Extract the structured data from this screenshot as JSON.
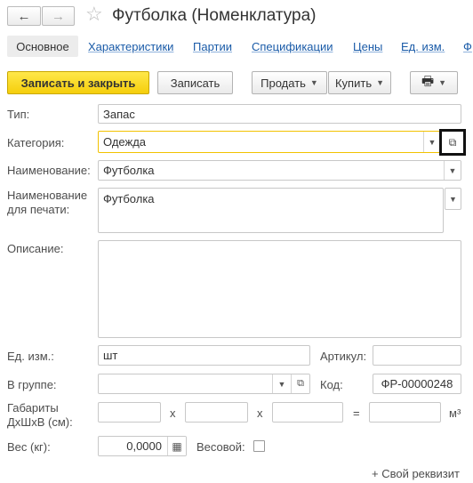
{
  "window": {
    "title": "Футболка (Номенклатура)"
  },
  "nav": {
    "back_icon": "←",
    "forward_icon": "→",
    "favorite_icon": "☆"
  },
  "tabs": [
    {
      "label": "Основное",
      "active": true
    },
    {
      "label": "Характеристики"
    },
    {
      "label": "Партии"
    },
    {
      "label": "Спецификации"
    },
    {
      "label": "Цены"
    },
    {
      "label": "Ед. изм."
    },
    {
      "label": "Ф"
    }
  ],
  "toolbar": {
    "save_close_label": "Записать и закрыть",
    "save_label": "Записать",
    "sell_label": "Продать",
    "buy_label": "Купить",
    "print_icon": "🖶",
    "dropdown_caret": "▼"
  },
  "form": {
    "type": {
      "label": "Тип:",
      "value": "Запас"
    },
    "category": {
      "label": "Категория:",
      "value": "Одежда",
      "open_icon": "⧉"
    },
    "name": {
      "label": "Наименование:",
      "value": "Футболка"
    },
    "print_name": {
      "label_line1": "Наименование",
      "label_line2": "для печати:",
      "value": "Футболка"
    },
    "description": {
      "label": "Описание:",
      "value": ""
    },
    "unit": {
      "label": "Ед. изм.:",
      "value": "шт"
    },
    "article": {
      "label": "Артикул:",
      "value": ""
    },
    "group": {
      "label": "В группе:",
      "value": ""
    },
    "code": {
      "label": "Код:",
      "value": "ФР-00000248"
    },
    "dimensions": {
      "label_line1": "Габариты",
      "label_line2": "ДхШхВ (см):",
      "x_symbol": "x",
      "eq_symbol": "=",
      "unit": "м³"
    },
    "weight": {
      "label": "Вес (кг):",
      "value": "0,0000",
      "calc_icon": "▦"
    },
    "weighted": {
      "label": "Весовой:"
    }
  },
  "footer": {
    "add_attribute_label": "+ Свой реквизит"
  },
  "colors": {
    "accent": "#f5ce0b",
    "link": "#1a5ba8",
    "focus_frame": "#111111"
  }
}
